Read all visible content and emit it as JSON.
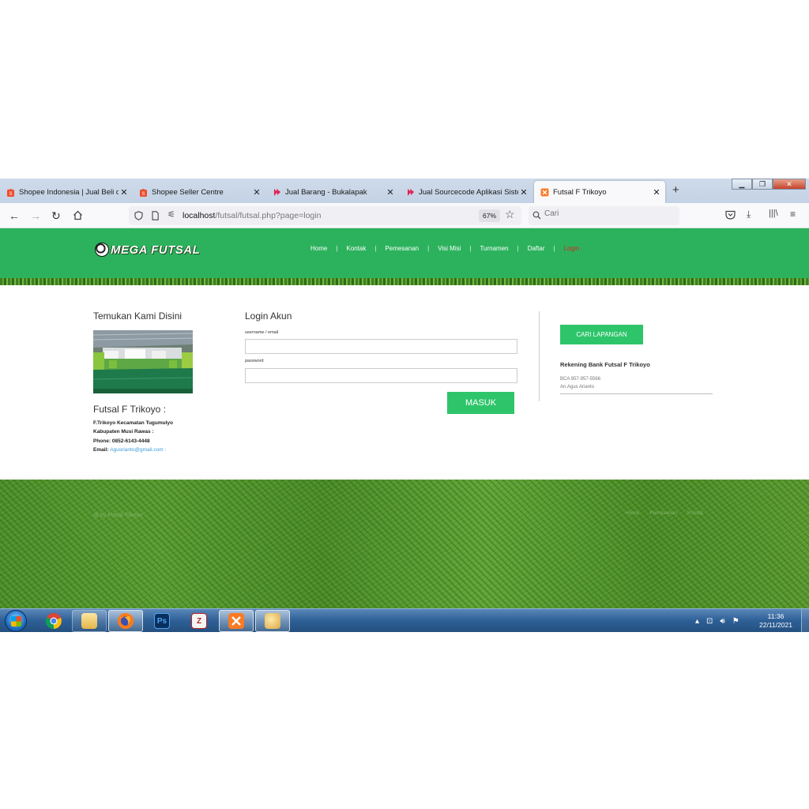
{
  "browser": {
    "tabs": [
      {
        "label": "Shopee Indonesia | Jual Beli di P",
        "icon": "shopee-icon",
        "active": false
      },
      {
        "label": "Shopee Seller Centre",
        "icon": "shopee-icon",
        "active": false
      },
      {
        "label": "Jual Barang - Bukalapak",
        "icon": "bukalapak-icon",
        "active": false
      },
      {
        "label": "Jual Sourcecode Aplikasi Sistem",
        "icon": "bukalapak-icon",
        "active": false
      },
      {
        "label": "Futsal F Trikoyo",
        "icon": "xampp-icon",
        "active": true
      }
    ],
    "url_host": "localhost",
    "url_path": "/futsal/futsal.php?page=login",
    "zoom": "67%",
    "search_placeholder": "Cari",
    "colors": {
      "tabbar": "#c7d6e8",
      "toolbar": "#f9f9fb"
    }
  },
  "site": {
    "logo": "MEGA FUTSAL",
    "menu": [
      "Home",
      "Kontak",
      "Pemesanan",
      "Visi Misi",
      "Turnamen",
      "Daftar",
      "Login"
    ],
    "menu_active": "Login",
    "colors": {
      "header": "#2cb25d",
      "active_menu": "#d7281f",
      "button": "#2ec56a",
      "email_link": "#3a9ad9"
    },
    "left": {
      "heading": "Temukan Kami Disini",
      "name_heading": "Futsal F Trikoyo :",
      "address1": "F.Trikoyo Kecamatan Tugumulyo",
      "address2": "Kabupaten Musi Rawas :",
      "phone_label": "Phone:",
      "phone": "0852-6143-4448",
      "email_label": "Email:",
      "email": "Agusrianto@gmail.com :"
    },
    "login": {
      "heading": "Login Akun",
      "username_label": "username / email",
      "password_label": "password",
      "submit": "MASUK"
    },
    "right": {
      "cari_button": "CARI LAPANGAN",
      "bank_heading": "Rekening Bank Futsal F Trikoyo",
      "bank_line1": "BCA 957-957-5566",
      "bank_line2": "An.Agus Arianto"
    },
    "footer": {
      "copyright": "@ by Futsal Trikoyo",
      "menu": [
        "Home",
        "Pemesanan",
        "Kontak"
      ]
    }
  },
  "taskbar": {
    "apps": [
      "chrome-icon",
      "explorer-icon",
      "firefox-icon",
      "photoshop-icon",
      "filezilla-icon",
      "xampp-icon",
      "paint-icon"
    ],
    "time": "11:36",
    "date": "22/11/2021"
  }
}
